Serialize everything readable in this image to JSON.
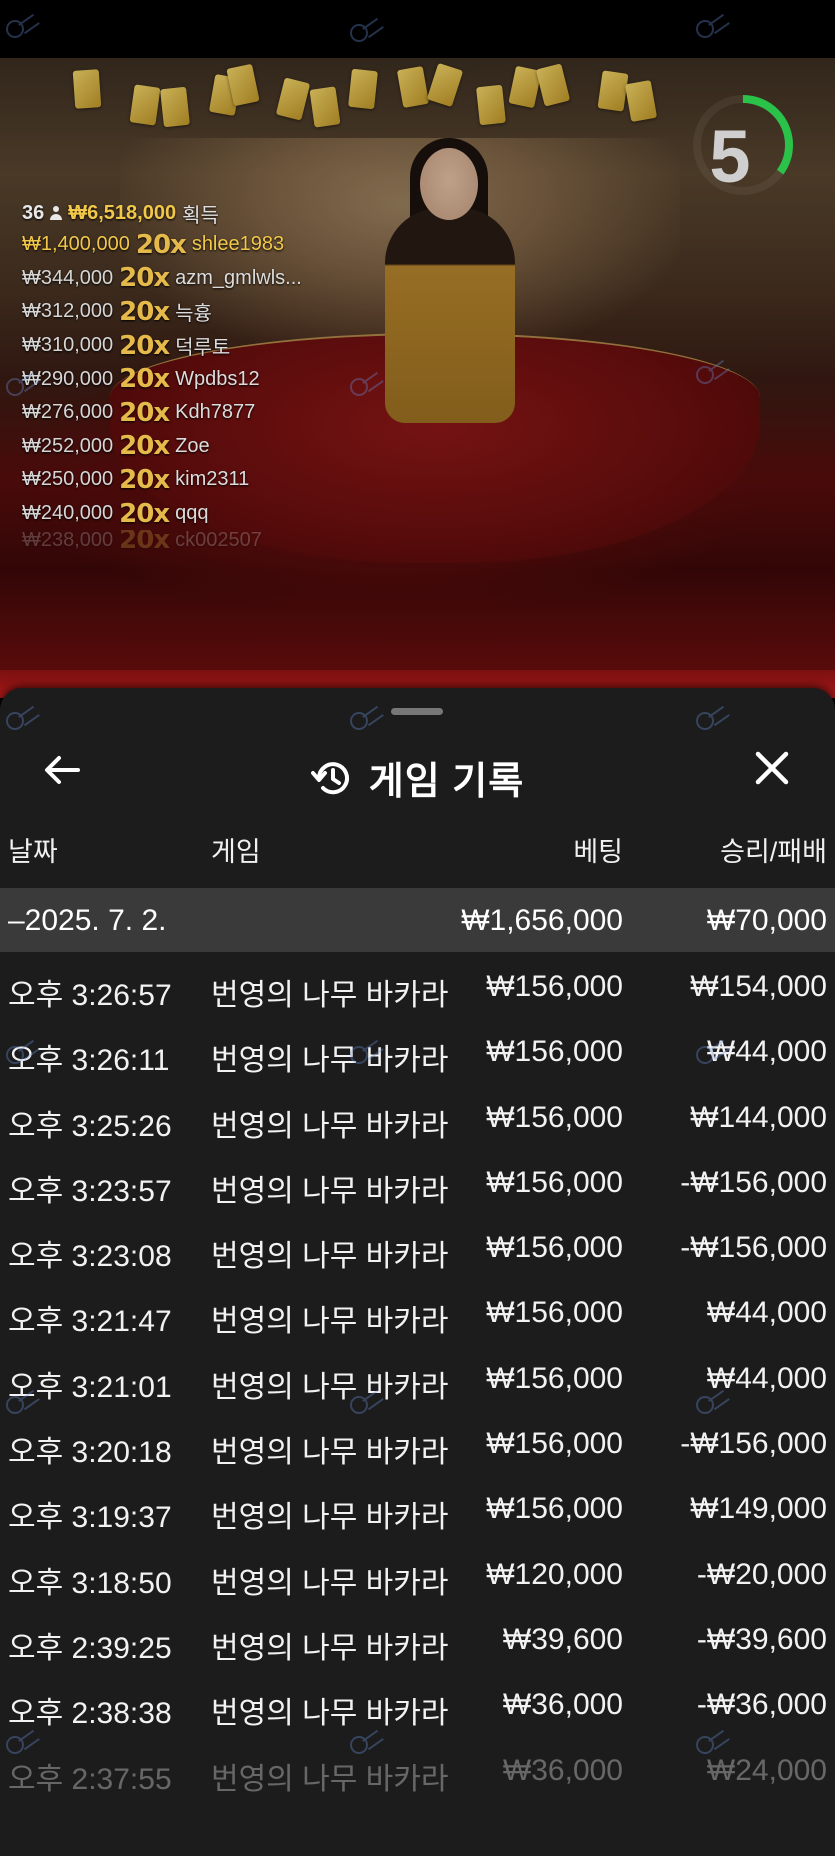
{
  "stream": {
    "timer": "5",
    "timer_progress": 0.35,
    "winners_count": "36",
    "winners_total": "₩6,518,000",
    "winners_suffix": "획득",
    "winners": [
      {
        "amount": "₩1,400,000",
        "multiplier": "20x",
        "name": "shlee1983"
      },
      {
        "amount": "₩344,000",
        "multiplier": "20x",
        "name": "azm_gmlwls..."
      },
      {
        "amount": "₩312,000",
        "multiplier": "20x",
        "name": "늑흉"
      },
      {
        "amount": "₩310,000",
        "multiplier": "20x",
        "name": "덕루토"
      },
      {
        "amount": "₩290,000",
        "multiplier": "20x",
        "name": "Wpdbs12"
      },
      {
        "amount": "₩276,000",
        "multiplier": "20x",
        "name": "Kdh7877"
      },
      {
        "amount": "₩252,000",
        "multiplier": "20x",
        "name": "Zoe"
      },
      {
        "amount": "₩250,000",
        "multiplier": "20x",
        "name": "kim2311"
      },
      {
        "amount": "₩240,000",
        "multiplier": "20x",
        "name": "qqq"
      },
      {
        "amount": "₩238,000",
        "multiplier": "20x",
        "name": "ck002507"
      }
    ]
  },
  "history": {
    "title": "게임 기록",
    "columns": {
      "date": "날짜",
      "game": "게임",
      "bet": "베팅",
      "result": "승리/패배"
    },
    "day": {
      "date": "–2025. 7. 2.",
      "bet": "₩1,656,000",
      "result": "₩70,000"
    },
    "rows": [
      {
        "time": "오후 3:26:57",
        "game": "번영의 나무 바카라",
        "bet": "₩156,000",
        "result": "₩154,000"
      },
      {
        "time": "오후 3:26:11",
        "game": "번영의 나무 바카라",
        "bet": "₩156,000",
        "result": "₩44,000"
      },
      {
        "time": "오후 3:25:26",
        "game": "번영의 나무 바카라",
        "bet": "₩156,000",
        "result": "₩144,000"
      },
      {
        "time": "오후 3:23:57",
        "game": "번영의 나무 바카라",
        "bet": "₩156,000",
        "result": "-₩156,000"
      },
      {
        "time": "오후 3:23:08",
        "game": "번영의 나무 바카라",
        "bet": "₩156,000",
        "result": "-₩156,000"
      },
      {
        "time": "오후 3:21:47",
        "game": "번영의 나무 바카라",
        "bet": "₩156,000",
        "result": "₩44,000"
      },
      {
        "time": "오후 3:21:01",
        "game": "번영의 나무 바카라",
        "bet": "₩156,000",
        "result": "₩44,000"
      },
      {
        "time": "오후 3:20:18",
        "game": "번영의 나무 바카라",
        "bet": "₩156,000",
        "result": "-₩156,000"
      },
      {
        "time": "오후 3:19:37",
        "game": "번영의 나무 바카라",
        "bet": "₩156,000",
        "result": "₩149,000"
      },
      {
        "time": "오후 3:18:50",
        "game": "번영의 나무 바카라",
        "bet": "₩120,000",
        "result": "-₩20,000"
      },
      {
        "time": "오후 2:39:25",
        "game": "번영의 나무 바카라",
        "bet": "₩39,600",
        "result": "-₩39,600"
      },
      {
        "time": "오후 2:38:38",
        "game": "번영의 나무 바카라",
        "bet": "₩36,000",
        "result": "-₩36,000"
      },
      {
        "time": "오후 2:37:55",
        "game": "번영의 나무 바카라",
        "bet": "₩36,000",
        "result": "₩24,000"
      }
    ]
  },
  "colors": {
    "accent_gold": "#f2c84b",
    "timer_green": "#2bc24a",
    "sheet_bg": "#1c1c1c",
    "day_row_bg": "#3a3a3a"
  }
}
